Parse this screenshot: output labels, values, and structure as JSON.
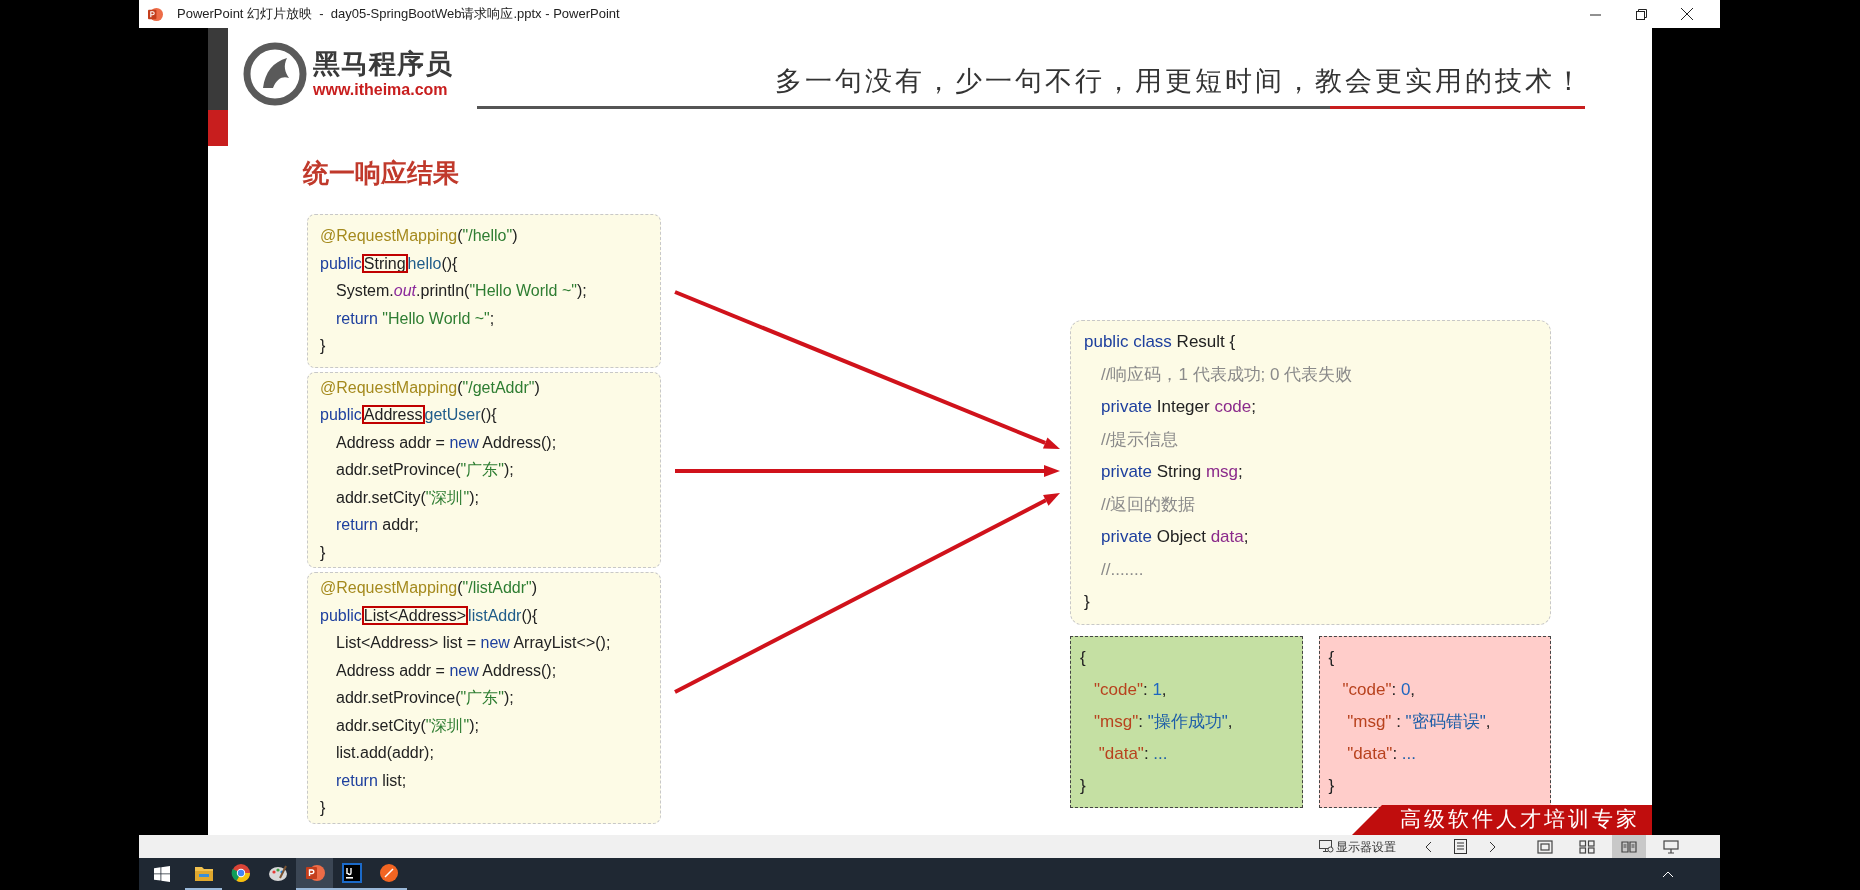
{
  "window": {
    "title": "PowerPoint 幻灯片放映  -  day05-SpringBootWeb请求响应.pptx - PowerPoint"
  },
  "slide": {
    "brand": {
      "name": "黑马程序员",
      "url": "www.itheima.com"
    },
    "slogan": "多一句没有，少一句不行，用更短时间，教会更实用的技术！",
    "title": "统一响应结果",
    "left_code_blocks": [
      {
        "lines": [
          {
            "indented": false,
            "tokens": [
              {
                "text": "@RequestMapping",
                "kind": "annotation"
              },
              {
                "text": "(",
                "kind": "plain"
              },
              {
                "text": "\"/hello\"",
                "kind": "string"
              },
              {
                "text": ")",
                "kind": "plain"
              }
            ]
          },
          {
            "indented": false,
            "tokens": [
              {
                "text": "public",
                "kind": "keyword"
              },
              {
                "text": "String",
                "kind": "boxed"
              },
              {
                "text": "hello",
                "kind": "method"
              },
              {
                "text": "(){",
                "kind": "plain"
              }
            ]
          },
          {
            "indented": true,
            "tokens": [
              {
                "text": "System.",
                "kind": "plain"
              },
              {
                "text": "out",
                "kind": "static"
              },
              {
                "text": ".println(",
                "kind": "plain"
              },
              {
                "text": "\"Hello World ~\"",
                "kind": "string"
              },
              {
                "text": ");",
                "kind": "plain"
              }
            ]
          },
          {
            "indented": true,
            "tokens": [
              {
                "text": "return ",
                "kind": "keyword"
              },
              {
                "text": "\"Hello World ~\"",
                "kind": "string"
              },
              {
                "text": ";",
                "kind": "plain"
              }
            ]
          },
          {
            "indented": false,
            "tokens": [
              {
                "text": "}",
                "kind": "plain"
              }
            ]
          }
        ]
      },
      {
        "lines": [
          {
            "indented": false,
            "tokens": [
              {
                "text": "@RequestMapping",
                "kind": "annotation"
              },
              {
                "text": "(",
                "kind": "plain"
              },
              {
                "text": "\"/getAddr\"",
                "kind": "string"
              },
              {
                "text": ")",
                "kind": "plain"
              }
            ]
          },
          {
            "indented": false,
            "tokens": [
              {
                "text": "public",
                "kind": "keyword"
              },
              {
                "text": "Address",
                "kind": "boxed"
              },
              {
                "text": "getUser",
                "kind": "method"
              },
              {
                "text": "(){",
                "kind": "plain"
              }
            ]
          },
          {
            "indented": true,
            "tokens": [
              {
                "text": "Address addr = ",
                "kind": "plain"
              },
              {
                "text": "new",
                "kind": "keyword"
              },
              {
                "text": " Address();",
                "kind": "plain"
              }
            ]
          },
          {
            "indented": true,
            "tokens": [
              {
                "text": "addr.setProvince(",
                "kind": "plain"
              },
              {
                "text": "\"广东\"",
                "kind": "string"
              },
              {
                "text": ");",
                "kind": "plain"
              }
            ]
          },
          {
            "indented": true,
            "tokens": [
              {
                "text": "addr.setCity(",
                "kind": "plain"
              },
              {
                "text": "\"深圳\"",
                "kind": "string"
              },
              {
                "text": ");",
                "kind": "plain"
              }
            ]
          },
          {
            "indented": true,
            "tokens": [
              {
                "text": "return",
                "kind": "keyword"
              },
              {
                "text": " addr;",
                "kind": "plain"
              }
            ]
          },
          {
            "indented": false,
            "tokens": [
              {
                "text": "}",
                "kind": "plain"
              }
            ]
          }
        ]
      },
      {
        "lines": [
          {
            "indented": false,
            "tokens": [
              {
                "text": "@RequestMapping",
                "kind": "annotation"
              },
              {
                "text": "(",
                "kind": "plain"
              },
              {
                "text": "\"/listAddr\"",
                "kind": "string"
              },
              {
                "text": ")",
                "kind": "plain"
              }
            ]
          },
          {
            "indented": false,
            "tokens": [
              {
                "text": "public",
                "kind": "keyword"
              },
              {
                "text": "List<Address>",
                "kind": "boxed"
              },
              {
                "text": "listAddr",
                "kind": "method"
              },
              {
                "text": "(){",
                "kind": "plain"
              }
            ]
          },
          {
            "indented": true,
            "tokens": [
              {
                "text": "List<Address> list = ",
                "kind": "plain"
              },
              {
                "text": "new",
                "kind": "keyword"
              },
              {
                "text": " ArrayList<>();",
                "kind": "plain"
              }
            ]
          },
          {
            "indented": true,
            "tokens": [
              {
                "text": "Address addr = ",
                "kind": "plain"
              },
              {
                "text": "new",
                "kind": "keyword"
              },
              {
                "text": " Address();",
                "kind": "plain"
              }
            ]
          },
          {
            "indented": true,
            "tokens": [
              {
                "text": "addr.setProvince(",
                "kind": "plain"
              },
              {
                "text": "\"广东\"",
                "kind": "string"
              },
              {
                "text": ");",
                "kind": "plain"
              }
            ]
          },
          {
            "indented": true,
            "tokens": [
              {
                "text": "addr.setCity(",
                "kind": "plain"
              },
              {
                "text": "\"深圳\"",
                "kind": "string"
              },
              {
                "text": ");",
                "kind": "plain"
              }
            ]
          },
          {
            "indented": true,
            "tokens": [
              {
                "text": "list.add(addr);",
                "kind": "plain"
              }
            ]
          },
          {
            "indented": true,
            "tokens": [
              {
                "text": "return",
                "kind": "keyword"
              },
              {
                "text": " list;",
                "kind": "plain"
              }
            ]
          },
          {
            "indented": false,
            "tokens": [
              {
                "text": "}",
                "kind": "plain"
              }
            ]
          }
        ]
      }
    ],
    "result_class": {
      "lines": [
        {
          "indented": false,
          "tokens": [
            {
              "text": "public class",
              "kind": "keyword"
            },
            {
              "text": " Result {",
              "kind": "plain"
            }
          ]
        },
        {
          "indented": true,
          "tokens": [
            {
              "text": "//响应码，1 代表成功; 0 代表失败",
              "kind": "comment"
            }
          ]
        },
        {
          "indented": true,
          "tokens": [
            {
              "text": "private",
              "kind": "keyword"
            },
            {
              "text": " Integer ",
              "kind": "plain"
            },
            {
              "text": "code",
              "kind": "field"
            },
            {
              "text": ";",
              "kind": "plain"
            }
          ]
        },
        {
          "indented": true,
          "tokens": [
            {
              "text": "//提示信息",
              "kind": "comment"
            }
          ]
        },
        {
          "indented": true,
          "tokens": [
            {
              "text": "private",
              "kind": "keyword"
            },
            {
              "text": " String ",
              "kind": "plain"
            },
            {
              "text": "msg",
              "kind": "field"
            },
            {
              "text": ";",
              "kind": "plain"
            }
          ]
        },
        {
          "indented": true,
          "tokens": [
            {
              "text": "//返回的数据",
              "kind": "comment"
            }
          ]
        },
        {
          "indented": true,
          "tokens": [
            {
              "text": "private",
              "kind": "keyword"
            },
            {
              "text": " Object ",
              "kind": "plain"
            },
            {
              "text": "data",
              "kind": "field"
            },
            {
              "text": ";",
              "kind": "plain"
            }
          ]
        },
        {
          "indented": true,
          "tokens": [
            {
              "text": "//.......",
              "kind": "comment"
            }
          ]
        },
        {
          "indented": false,
          "tokens": [
            {
              "text": "}",
              "kind": "plain"
            }
          ]
        }
      ]
    },
    "response_examples": [
      {
        "color": "#c5e0a3",
        "lines": [
          {
            "indented": false,
            "tokens": [
              {
                "text": "{",
                "kind": "plain"
              }
            ]
          },
          {
            "indented": true,
            "tokens": [
              {
                "text": "\"code\"",
                "kind": "key"
              },
              {
                "text": ": ",
                "kind": "plain"
              },
              {
                "text": "1",
                "kind": "number"
              },
              {
                "text": ",",
                "kind": "plain"
              }
            ]
          },
          {
            "indented": true,
            "tokens": [
              {
                "text": "\"msg\"",
                "kind": "key"
              },
              {
                "text": ": ",
                "kind": "plain"
              },
              {
                "text": "\"操作成功\"",
                "kind": "value"
              },
              {
                "text": ",",
                "kind": "plain"
              }
            ]
          },
          {
            "indented": true,
            "tokens": [
              {
                "text": " \"data\"",
                "kind": "key"
              },
              {
                "text": ": ",
                "kind": "plain"
              },
              {
                "text": "...",
                "kind": "value"
              }
            ]
          },
          {
            "indented": false,
            "tokens": [
              {
                "text": "}",
                "kind": "plain"
              }
            ]
          }
        ]
      },
      {
        "color": "#ffcdca",
        "lines": [
          {
            "indented": false,
            "tokens": [
              {
                "text": "{",
                "kind": "plain"
              }
            ]
          },
          {
            "indented": true,
            "tokens": [
              {
                "text": "\"code\"",
                "kind": "key"
              },
              {
                "text": ": ",
                "kind": "plain"
              },
              {
                "text": "0",
                "kind": "number"
              },
              {
                "text": ",",
                "kind": "plain"
              }
            ]
          },
          {
            "indented": true,
            "tokens": [
              {
                "text": " \"msg\"",
                "kind": "key"
              },
              {
                "text": " : ",
                "kind": "plain"
              },
              {
                "text": "\"密码错误\"",
                "kind": "value"
              },
              {
                "text": ",",
                "kind": "plain"
              }
            ]
          },
          {
            "indented": true,
            "tokens": [
              {
                "text": " \"data\"",
                "kind": "key"
              },
              {
                "text": ": ",
                "kind": "plain"
              },
              {
                "text": "...",
                "kind": "value"
              }
            ]
          },
          {
            "indented": false,
            "tokens": [
              {
                "text": "}",
                "kind": "plain"
              }
            ]
          }
        ]
      }
    ],
    "banner": "高级软件人才培训专家"
  },
  "status_bar": {
    "display_settings": "显示器设置",
    "views": [
      {
        "kind": "normal",
        "selected": false
      },
      {
        "kind": "sorter",
        "selected": false
      },
      {
        "kind": "reading",
        "selected": true
      },
      {
        "kind": "slideshow",
        "selected": false
      }
    ]
  },
  "taskbar": {
    "apps": [
      {
        "kind": "files",
        "running": true,
        "selected": false
      },
      {
        "kind": "browser",
        "running": false,
        "selected": false
      },
      {
        "kind": "paint",
        "running": false,
        "selected": false
      },
      {
        "kind": "slides",
        "running": true,
        "selected": true
      },
      {
        "kind": "ide",
        "running": true,
        "selected": false
      },
      {
        "kind": "compass",
        "running": true,
        "selected": false
      }
    ]
  }
}
